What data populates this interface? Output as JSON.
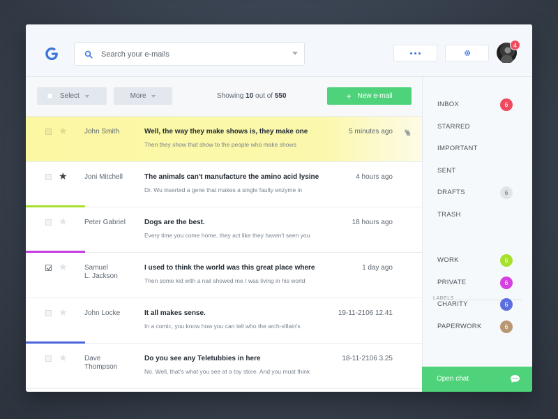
{
  "header": {
    "logo": "G",
    "search_placeholder": "Search your e-mails",
    "avatar_badge": "4"
  },
  "toolbar": {
    "select_label": "Select",
    "more_label": "More",
    "showing_prefix": "Showing ",
    "showing_count": "10",
    "showing_mid": " out of ",
    "showing_total": "550",
    "new_email_label": "New e-mail"
  },
  "emails": [
    {
      "sender": "John Smith",
      "subject": "Well, the way they make shows is, they make one",
      "preview": "Then they show that show to the people who make shows",
      "time": "5 minutes ago",
      "starred": false,
      "checked": false,
      "highlighted": true,
      "attachment": true,
      "accent": ""
    },
    {
      "sender": "Joni Mitchell",
      "subject": "The animals can't manufacture the amino acid lysine",
      "preview": "Dr. Wu inserted a gene that makes a single faulty enzyme in",
      "time": "4 hours ago",
      "starred": true,
      "checked": false,
      "highlighted": false,
      "attachment": false,
      "accent": "#a6e02c"
    },
    {
      "sender": "Peter Gabriel",
      "subject": "Dogs are the best.",
      "preview": "Every time you come home, they act like they haven't seen you",
      "time": "18 hours ago",
      "starred": false,
      "checked": false,
      "highlighted": false,
      "attachment": false,
      "accent": "#c23ce0"
    },
    {
      "sender": "Samuel\nL. Jackson",
      "subject": "I used to think the world was this great place where",
      "preview": "Then some kid with a nail showed me I was living in his world",
      "time": "1 day ago",
      "starred": false,
      "checked": true,
      "highlighted": false,
      "attachment": false,
      "accent": ""
    },
    {
      "sender": "John Locke",
      "subject": "It all makes sense.",
      "preview": "In a comic, you know how you can tell who the arch-villain's",
      "time": "19-11-2106  12.41",
      "starred": false,
      "checked": false,
      "highlighted": false,
      "attachment": false,
      "accent": "#4a64dc"
    },
    {
      "sender": "Dave\nThompson",
      "subject": "Do you see any Teletubbies in here",
      "preview": "No. Well, that's what you see at a toy store. And you must think",
      "time": "18-11-2106  3.25",
      "starred": false,
      "checked": false,
      "highlighted": false,
      "attachment": false,
      "accent": ""
    }
  ],
  "sidebar": {
    "folders": [
      {
        "label": "INBOX",
        "count": "6",
        "color": "#ef4a5d"
      },
      {
        "label": "STARRED",
        "count": "",
        "color": ""
      },
      {
        "label": "IMPORTANT",
        "count": "",
        "color": ""
      },
      {
        "label": "SENT",
        "count": "",
        "color": ""
      },
      {
        "label": "DRAFTS",
        "count": "6",
        "color": "#e1e5ea"
      },
      {
        "label": "TRASH",
        "count": "",
        "color": ""
      }
    ],
    "labels_heading": "LABELS",
    "labels": [
      {
        "label": "WORK",
        "count": "6",
        "color": "#a6e02c"
      },
      {
        "label": "PRIVATE",
        "count": "6",
        "color": "#d63fe0"
      },
      {
        "label": "CHARITY",
        "count": "6",
        "color": "#5b6ee0"
      },
      {
        "label": "PAPERWORK",
        "count": "6",
        "color": "#b89873"
      }
    ],
    "chat_label": "Open chat"
  },
  "colors": {
    "accent_green": "#4fd37a",
    "brand_blue": "#3c74d9",
    "badge_red": "#ef4a5d"
  }
}
